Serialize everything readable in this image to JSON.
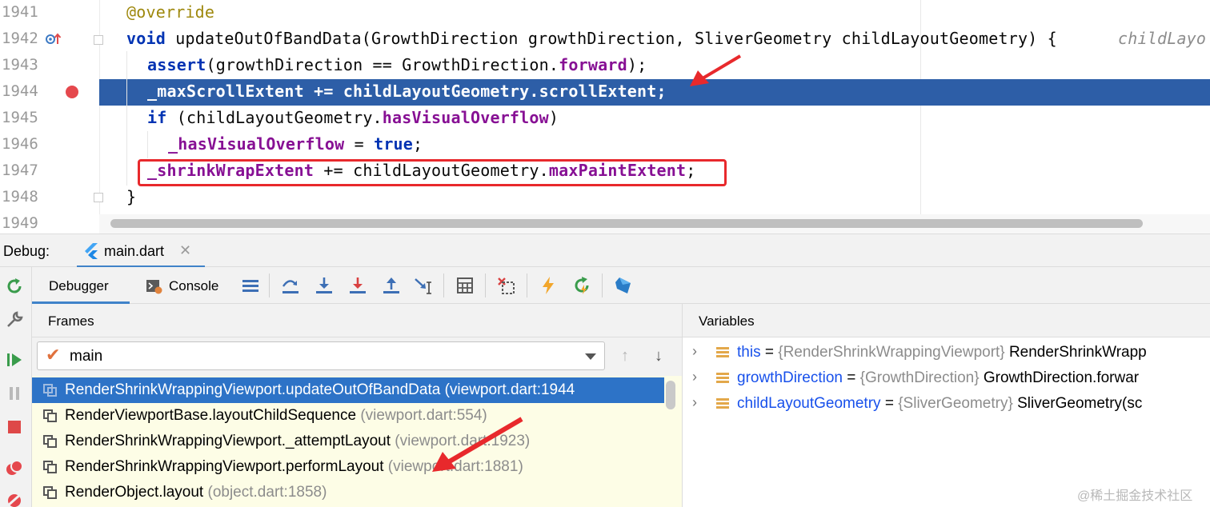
{
  "editor": {
    "lines": [
      {
        "num": "1941",
        "parts": [
          {
            "t": "@override",
            "c": "ann"
          }
        ]
      },
      {
        "num": "1942",
        "parts": [
          {
            "t": "void ",
            "c": "kw"
          },
          {
            "t": "updateOutOfBandData(GrowthDirection growthDirection, SliverGeometry childLayoutGeometry) {",
            "c": ""
          }
        ]
      },
      {
        "num": "1943",
        "parts": [
          {
            "t": "assert",
            "c": "kw"
          },
          {
            "t": "(growthDirection == GrowthDirection.",
            "c": ""
          },
          {
            "t": "forward",
            "c": "fld"
          },
          {
            "t": ");",
            "c": ""
          }
        ]
      },
      {
        "num": "1944",
        "parts": [
          {
            "t": "_maxScrollExtent += childLayoutGeometry.scrollExtent;",
            "c": ""
          }
        ]
      },
      {
        "num": "1945",
        "parts": [
          {
            "t": "if ",
            "c": "kw"
          },
          {
            "t": "(childLayoutGeometry.",
            "c": ""
          },
          {
            "t": "hasVisualOverflow",
            "c": "fld"
          },
          {
            "t": ")",
            "c": ""
          }
        ]
      },
      {
        "num": "1946",
        "parts": [
          {
            "t": "_hasVisualOverflow",
            "c": "fld"
          },
          {
            "t": " = ",
            "c": ""
          },
          {
            "t": "true",
            "c": "kw"
          },
          {
            "t": ";",
            "c": ""
          }
        ]
      },
      {
        "num": "1947",
        "parts": [
          {
            "t": "_shrinkWrapExtent",
            "c": "fld"
          },
          {
            "t": " += childLayoutGeometry.",
            "c": ""
          },
          {
            "t": "maxPaintExtent",
            "c": "fld"
          },
          {
            "t": ";",
            "c": ""
          }
        ]
      },
      {
        "num": "1948",
        "parts": [
          {
            "t": "}",
            "c": ""
          }
        ]
      },
      {
        "num": "1949",
        "parts": []
      }
    ],
    "inline_hint": "childLayo"
  },
  "debug": {
    "title": "Debug:",
    "session_tab": "main.dart",
    "tabs": {
      "debugger": "Debugger",
      "console": "Console"
    },
    "frames_header": "Frames",
    "variables_header": "Variables",
    "thread": "main",
    "frames": [
      {
        "method": "RenderShrinkWrappingViewport.updateOutOfBandData",
        "location": "(viewport.dart:1944"
      },
      {
        "method": "RenderViewportBase.layoutChildSequence",
        "location": "(viewport.dart:554)"
      },
      {
        "method": "RenderShrinkWrappingViewport._attemptLayout",
        "location": "(viewport.dart:1923)"
      },
      {
        "method": "RenderShrinkWrappingViewport.performLayout",
        "location": "(viewport.dart:1881)"
      },
      {
        "method": "RenderObject.layout",
        "location": "(object.dart:1858)"
      }
    ],
    "variables": [
      {
        "name": "this",
        "type": "{RenderShrinkWrappingViewport}",
        "value": "RenderShrinkWrapp"
      },
      {
        "name": "growthDirection",
        "type": "{GrowthDirection}",
        "value": "GrowthDirection.forwar"
      },
      {
        "name": "childLayoutGeometry",
        "type": "{SliverGeometry}",
        "value": "SliverGeometry(sc"
      }
    ]
  },
  "watermark": "@稀土掘金技术社区",
  "colors": {
    "selection": "#2d5ea7",
    "frame_selection": "#2d73c7",
    "annotation_red": "#e8292c",
    "keyword": "#0033b3",
    "field": "#871094",
    "breakpoint": "#e5484d"
  }
}
